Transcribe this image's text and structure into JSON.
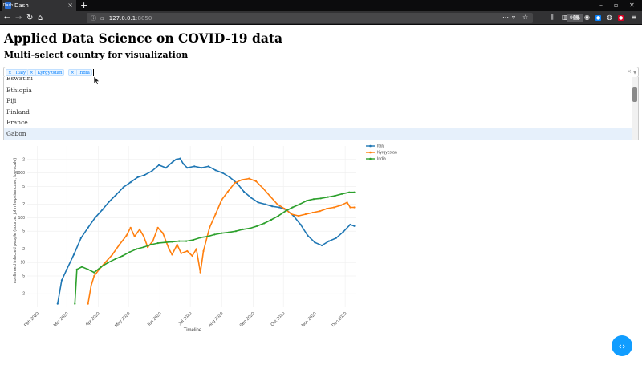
{
  "browser": {
    "tab_title": "Dash",
    "tab_favicon": "Dash",
    "new_tab": "+",
    "url_host": "127.0.0.1",
    "url_port": ":8050",
    "zoom": "90%",
    "window_controls": [
      "–",
      "▫",
      "✕"
    ]
  },
  "page": {
    "title": "Applied Data Science on COVID-19 data",
    "subtitle": "Multi-select country for visualization"
  },
  "dropdown": {
    "selected": [
      "Italy",
      "Kyrgyzstan",
      "India"
    ],
    "clear": "×",
    "options": [
      "Eswatini",
      "Ethiopia",
      "Fiji",
      "Finland",
      "France",
      "Gabon"
    ],
    "highlighted": "Gabon"
  },
  "fab_icon": "chevron-left-right-icon",
  "chart_data": {
    "type": "line",
    "ylabel": "confirmed infected people (source: john hopkins csse, log-scale)",
    "xlabel": "Timeline",
    "yscale": "log",
    "ylim": [
      1,
      4000
    ],
    "xlim": [
      "2020-01-22",
      "2020-12-12"
    ],
    "x_ticks": [
      "Feb 2020",
      "Mar 2020",
      "Apr 2020",
      "May 2020",
      "Jun 2020",
      "Jul 2020",
      "Aug 2020",
      "Sep 2020",
      "Oct 2020",
      "Nov 2020",
      "Dec 2020"
    ],
    "y_ticks": [
      {
        "v": 2,
        "label": "2"
      },
      {
        "v": 5,
        "label": "5"
      },
      {
        "v": 10,
        "label": "10"
      },
      {
        "v": 20,
        "label": "2"
      },
      {
        "v": 50,
        "label": "5"
      },
      {
        "v": 100,
        "label": "100"
      },
      {
        "v": 200,
        "label": "2"
      },
      {
        "v": 500,
        "label": "5"
      },
      {
        "v": 1000,
        "label": "1000"
      },
      {
        "v": 2000,
        "label": "2"
      }
    ],
    "legend_position": "top-right",
    "series": [
      {
        "name": "Italy",
        "color": "#1f77b4",
        "points": [
          [
            "2020-02-21",
            1.2
          ],
          [
            "2020-02-25",
            4
          ],
          [
            "2020-03-01",
            7
          ],
          [
            "2020-03-08",
            15
          ],
          [
            "2020-03-15",
            35
          ],
          [
            "2020-03-22",
            60
          ],
          [
            "2020-03-29",
            100
          ],
          [
            "2020-04-05",
            150
          ],
          [
            "2020-04-12",
            230
          ],
          [
            "2020-04-19",
            330
          ],
          [
            "2020-04-26",
            480
          ],
          [
            "2020-05-03",
            620
          ],
          [
            "2020-05-10",
            800
          ],
          [
            "2020-05-17",
            900
          ],
          [
            "2020-05-24",
            1100
          ],
          [
            "2020-05-31",
            1500
          ],
          [
            "2020-06-07",
            1300
          ],
          [
            "2020-06-14",
            1800
          ],
          [
            "2020-06-17",
            2000
          ],
          [
            "2020-06-21",
            2100
          ],
          [
            "2020-06-24",
            1600
          ],
          [
            "2020-06-28",
            1300
          ],
          [
            "2020-07-05",
            1400
          ],
          [
            "2020-07-12",
            1300
          ],
          [
            "2020-07-19",
            1400
          ],
          [
            "2020-07-26",
            1150
          ],
          [
            "2020-08-02",
            1000
          ],
          [
            "2020-08-09",
            800
          ],
          [
            "2020-08-16",
            600
          ],
          [
            "2020-08-23",
            380
          ],
          [
            "2020-08-30",
            280
          ],
          [
            "2020-09-06",
            220
          ],
          [
            "2020-09-13",
            200
          ],
          [
            "2020-09-20",
            180
          ],
          [
            "2020-09-27",
            170
          ],
          [
            "2020-10-04",
            150
          ],
          [
            "2020-10-11",
            110
          ],
          [
            "2020-10-18",
            70
          ],
          [
            "2020-10-25",
            40
          ],
          [
            "2020-11-01",
            28
          ],
          [
            "2020-11-08",
            24
          ],
          [
            "2020-11-15",
            30
          ],
          [
            "2020-11-22",
            35
          ],
          [
            "2020-11-29",
            48
          ],
          [
            "2020-12-06",
            70
          ],
          [
            "2020-12-10",
            65
          ]
        ]
      },
      {
        "name": "Kyrgyzstan",
        "color": "#ff7f0e",
        "points": [
          [
            "2020-03-22",
            1.2
          ],
          [
            "2020-03-25",
            3
          ],
          [
            "2020-03-28",
            5
          ],
          [
            "2020-04-02",
            7
          ],
          [
            "2020-04-08",
            10
          ],
          [
            "2020-04-15",
            15
          ],
          [
            "2020-04-22",
            25
          ],
          [
            "2020-04-29",
            40
          ],
          [
            "2020-05-03",
            60
          ],
          [
            "2020-05-07",
            38
          ],
          [
            "2020-05-12",
            55
          ],
          [
            "2020-05-16",
            38
          ],
          [
            "2020-05-20",
            22
          ],
          [
            "2020-05-25",
            30
          ],
          [
            "2020-05-30",
            60
          ],
          [
            "2020-06-04",
            45
          ],
          [
            "2020-06-10",
            20
          ],
          [
            "2020-06-13",
            15
          ],
          [
            "2020-06-18",
            25
          ],
          [
            "2020-06-22",
            16
          ],
          [
            "2020-06-28",
            18
          ],
          [
            "2020-07-03",
            14
          ],
          [
            "2020-07-07",
            20
          ],
          [
            "2020-07-11",
            6
          ],
          [
            "2020-07-14",
            18
          ],
          [
            "2020-07-20",
            60
          ],
          [
            "2020-07-26",
            120
          ],
          [
            "2020-08-01",
            250
          ],
          [
            "2020-08-07",
            380
          ],
          [
            "2020-08-14",
            600
          ],
          [
            "2020-08-21",
            700
          ],
          [
            "2020-08-28",
            750
          ],
          [
            "2020-09-04",
            650
          ],
          [
            "2020-09-11",
            450
          ],
          [
            "2020-09-18",
            300
          ],
          [
            "2020-09-25",
            200
          ],
          [
            "2020-10-02",
            160
          ],
          [
            "2020-10-09",
            120
          ],
          [
            "2020-10-16",
            110
          ],
          [
            "2020-10-23",
            120
          ],
          [
            "2020-10-30",
            130
          ],
          [
            "2020-11-06",
            140
          ],
          [
            "2020-11-13",
            160
          ],
          [
            "2020-11-20",
            170
          ],
          [
            "2020-11-27",
            190
          ],
          [
            "2020-12-03",
            220
          ],
          [
            "2020-12-06",
            170
          ],
          [
            "2020-12-10",
            170
          ]
        ]
      },
      {
        "name": "India",
        "color": "#2ca02c",
        "points": [
          [
            "2020-03-09",
            1.2
          ],
          [
            "2020-03-11",
            7
          ],
          [
            "2020-03-16",
            8
          ],
          [
            "2020-03-22",
            7
          ],
          [
            "2020-03-28",
            6
          ],
          [
            "2020-04-04",
            8
          ],
          [
            "2020-04-11",
            10
          ],
          [
            "2020-04-18",
            12
          ],
          [
            "2020-04-25",
            14
          ],
          [
            "2020-05-02",
            17
          ],
          [
            "2020-05-09",
            20
          ],
          [
            "2020-05-16",
            22
          ],
          [
            "2020-05-23",
            25
          ],
          [
            "2020-05-30",
            27
          ],
          [
            "2020-06-06",
            28
          ],
          [
            "2020-06-13",
            29
          ],
          [
            "2020-06-20",
            30
          ],
          [
            "2020-06-27",
            30
          ],
          [
            "2020-07-04",
            32
          ],
          [
            "2020-07-11",
            36
          ],
          [
            "2020-07-18",
            38
          ],
          [
            "2020-07-25",
            42
          ],
          [
            "2020-08-01",
            45
          ],
          [
            "2020-08-08",
            47
          ],
          [
            "2020-08-15",
            50
          ],
          [
            "2020-08-22",
            55
          ],
          [
            "2020-08-29",
            58
          ],
          [
            "2020-09-05",
            65
          ],
          [
            "2020-09-12",
            75
          ],
          [
            "2020-09-19",
            90
          ],
          [
            "2020-09-26",
            110
          ],
          [
            "2020-10-03",
            140
          ],
          [
            "2020-10-10",
            170
          ],
          [
            "2020-10-17",
            200
          ],
          [
            "2020-10-24",
            240
          ],
          [
            "2020-10-31",
            260
          ],
          [
            "2020-11-07",
            270
          ],
          [
            "2020-11-14",
            290
          ],
          [
            "2020-11-21",
            310
          ],
          [
            "2020-11-28",
            340
          ],
          [
            "2020-12-05",
            370
          ],
          [
            "2020-12-10",
            370
          ]
        ]
      }
    ]
  }
}
